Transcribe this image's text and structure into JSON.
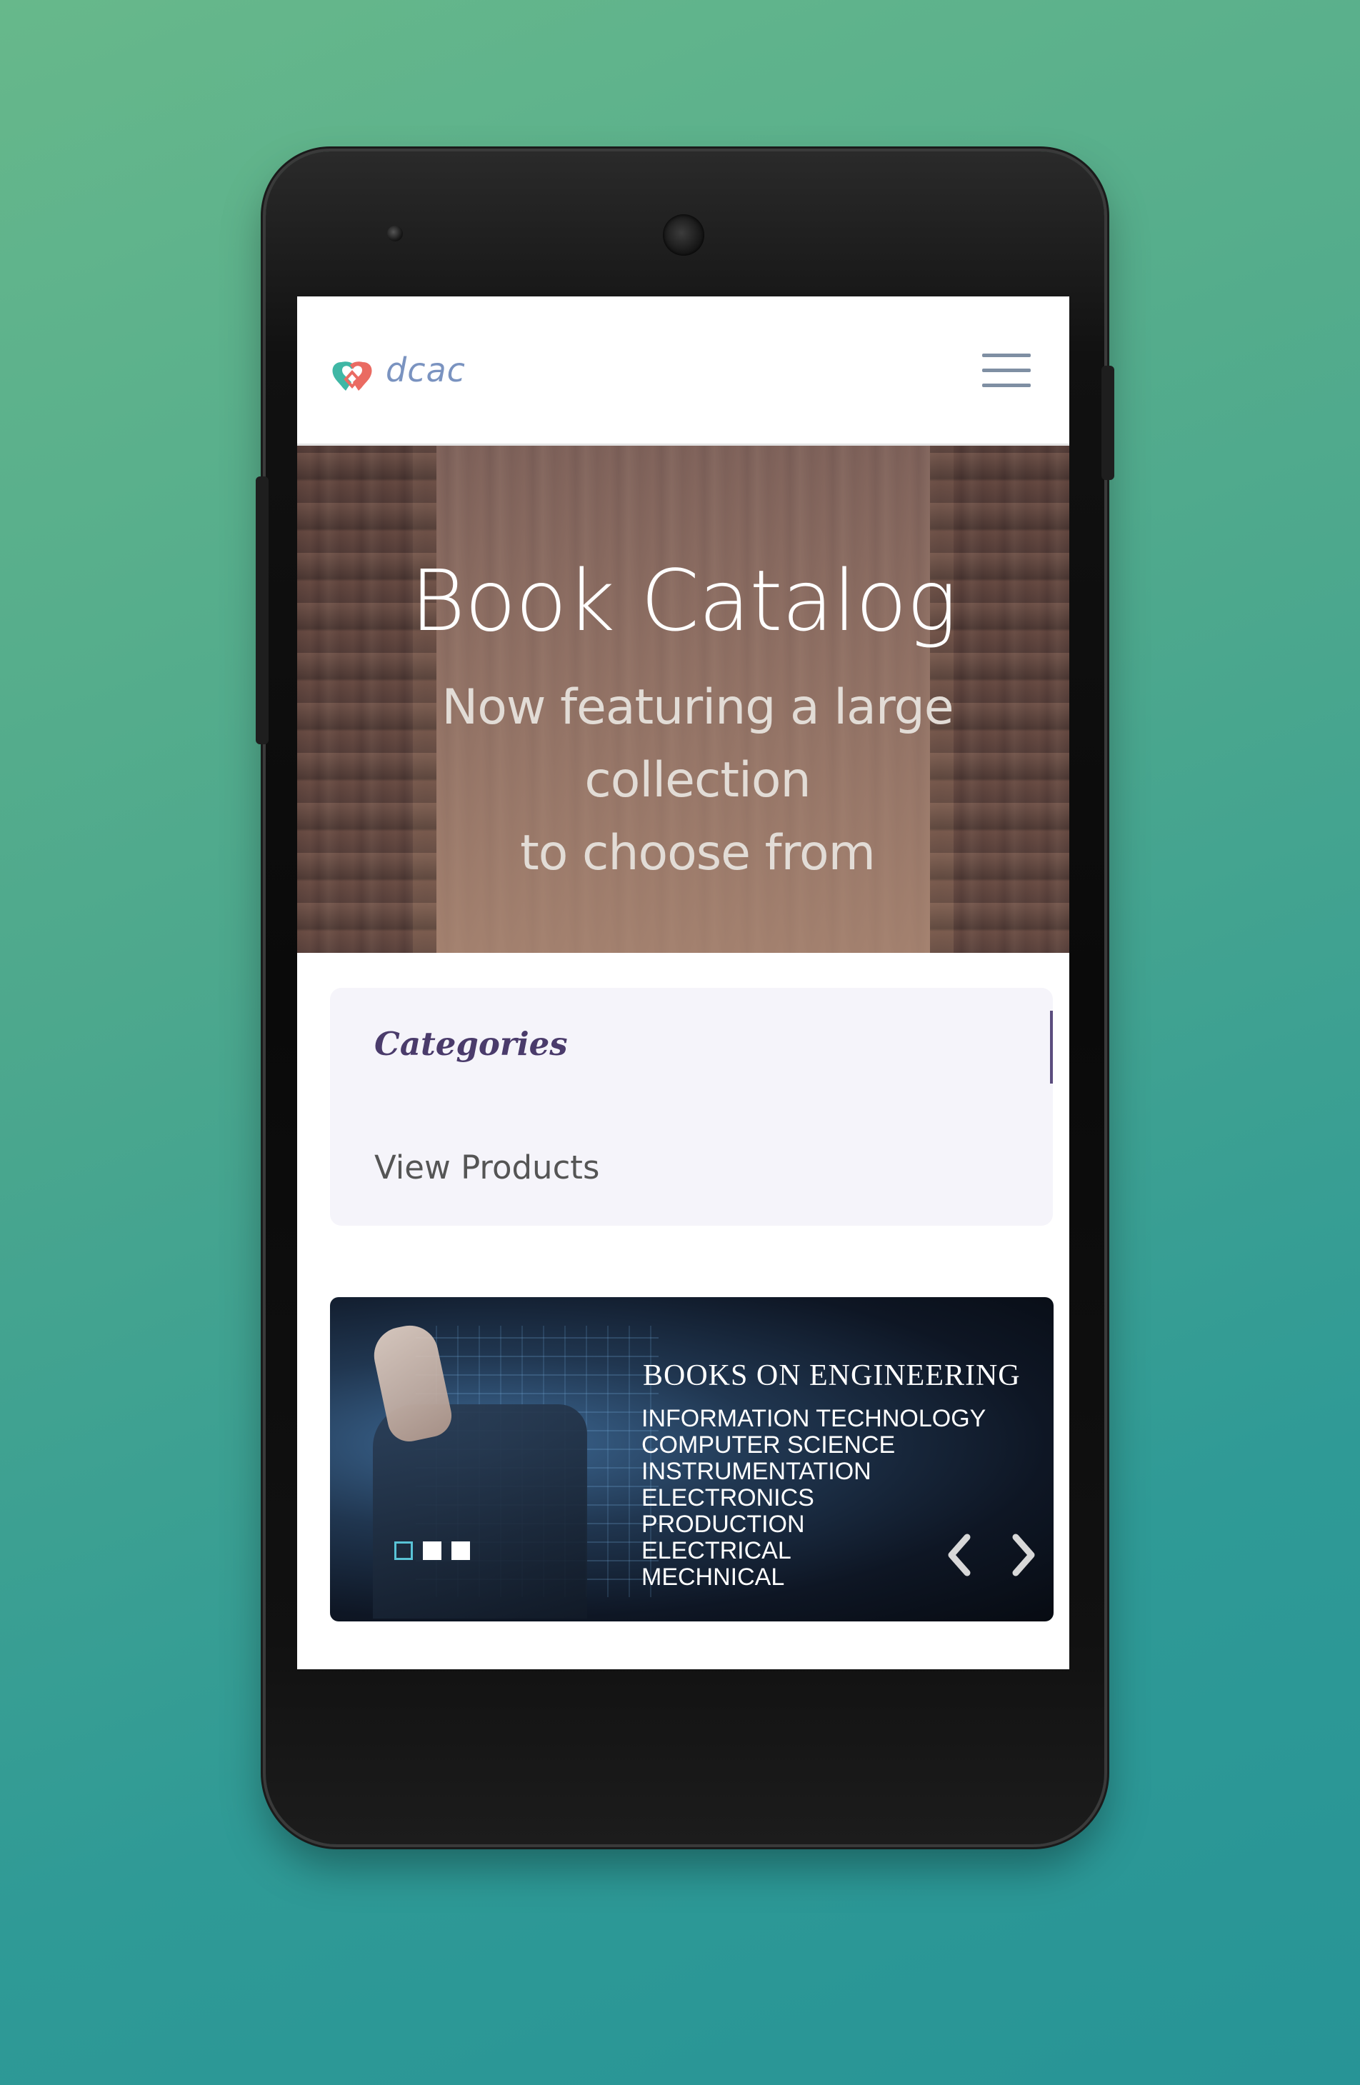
{
  "colors": {
    "background_gradient": [
      "#67b88b",
      "#279496"
    ],
    "brand_text": "#7a93c0",
    "menu_icon": "#7f8fa3",
    "categories_title": "#4a3b6b",
    "panel_background": "#f5f4fa",
    "active_indicator": "#59c3d6"
  },
  "navbar": {
    "logo_icon": "dcac-logo-icon",
    "brand_name": "dcac",
    "menu_icon": "hamburger-menu-icon"
  },
  "hero": {
    "title": "Book Catalog",
    "subtitle_line1": "Now featuring a large collection",
    "subtitle_line2": "to choose from"
  },
  "categories": {
    "title": "Categories",
    "link_label": "View Products"
  },
  "carousel": {
    "heading": "BOOKS ON ENGINEERING",
    "items": [
      "INFORMATION TECHNOLOGY",
      "COMPUTER SCIENCE",
      "INSTRUMENTATION",
      "ELECTRONICS",
      "PRODUCTION",
      "ELECTRICAL",
      "MECHNICAL"
    ],
    "slide_count": 3,
    "active_slide": 1,
    "prev_icon": "chevron-left-icon",
    "next_icon": "chevron-right-icon"
  }
}
